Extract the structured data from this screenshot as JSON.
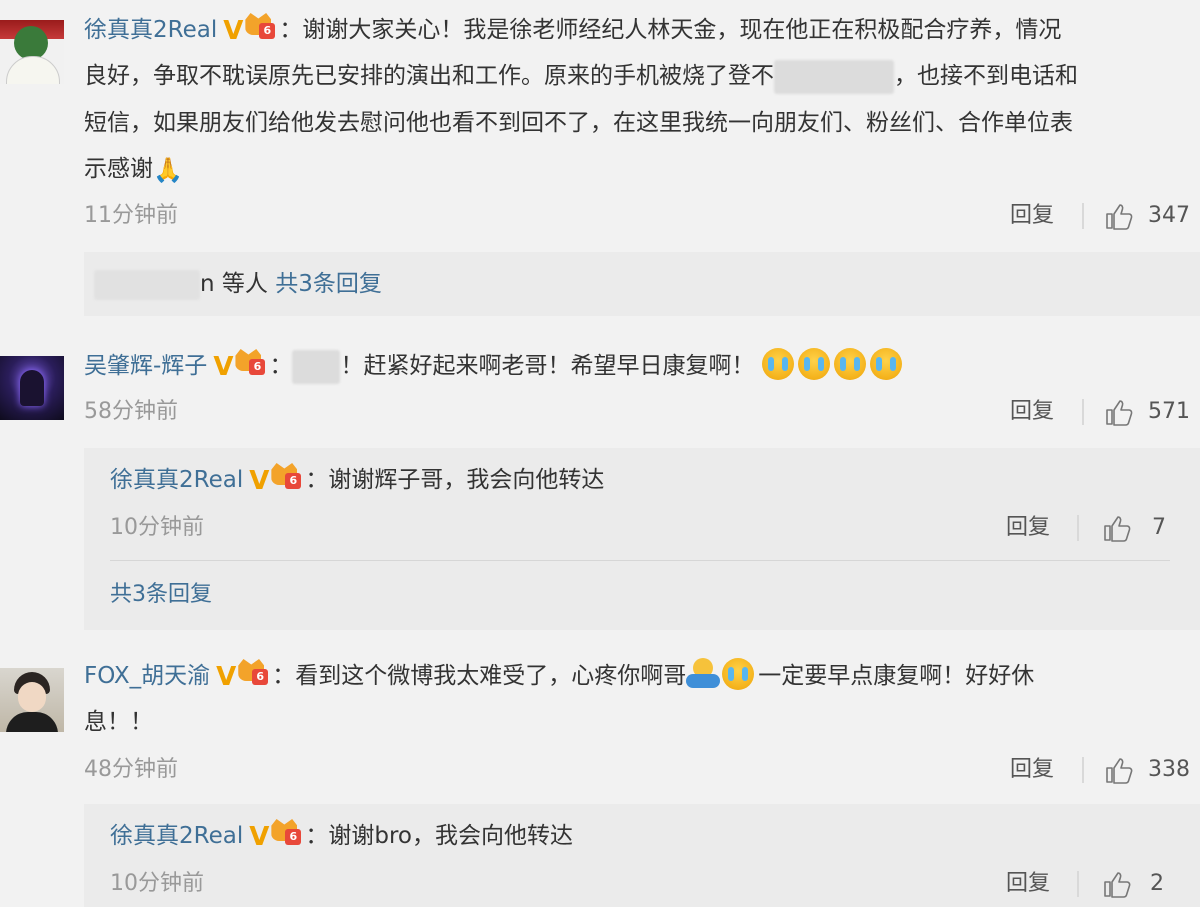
{
  "comments": [
    {
      "username": "徐真真2Real",
      "level": "6",
      "text_lines": [
        "谢谢大家关心！我是徐老师经纪人林天金，现在他正在积极配合疗养，情况",
        "良好，争取不耽误原先已安排的演出和工作。原来的手机被烧了登不",
        "，也接不到电话和",
        "短信，如果朋友们给他发去慰问他也看不到回不了，在这里我统一向朋友们、粉丝们、合作单位表",
        "示感谢"
      ],
      "time": "11分钟前",
      "reply_label": "回复",
      "likes": "347",
      "summary_fragment": "n",
      "summary_others": "等人",
      "summary_link": "共3条回复"
    },
    {
      "username": "吴肇辉-辉子",
      "level": "6",
      "text": "！赶紧好起来啊老哥！希望早日康复啊！",
      "time": "58分钟前",
      "reply_label": "回复",
      "likes": "571",
      "reply": {
        "username": "徐真真2Real",
        "level": "6",
        "text": "谢谢辉子哥，我会向他转达",
        "time": "10分钟前",
        "reply_label": "回复",
        "likes": "7"
      },
      "more_replies": "共3条回复"
    },
    {
      "username": "FOX_胡天渝",
      "level": "6",
      "text_a": "看到这个微博我太难受了，心疼你啊哥",
      "text_b": "一定要早点康复啊！好好休",
      "text_c": "息！！",
      "time": "48分钟前",
      "reply_label": "回复",
      "likes": "338",
      "reply": {
        "username": "徐真真2Real",
        "level": "6",
        "text": "谢谢bro，我会向他转达",
        "time": "10分钟前",
        "reply_label": "回复",
        "likes": "2"
      }
    }
  ],
  "colon": "：",
  "icons": {
    "verified": "verified-v-icon",
    "member": "crown-member-icon",
    "like": "thumbs-up-icon",
    "crying": "crying-emoji-icon",
    "hug": "hug-emoji-icon",
    "pray": "pray-emoji-icon"
  },
  "colors": {
    "username": "#3f6f96",
    "background": "#f2f2f2",
    "reply_background": "#ebebeb",
    "verified": "#f0a100"
  },
  "glyphs": {
    "verified": "V",
    "pray": "🙏"
  }
}
